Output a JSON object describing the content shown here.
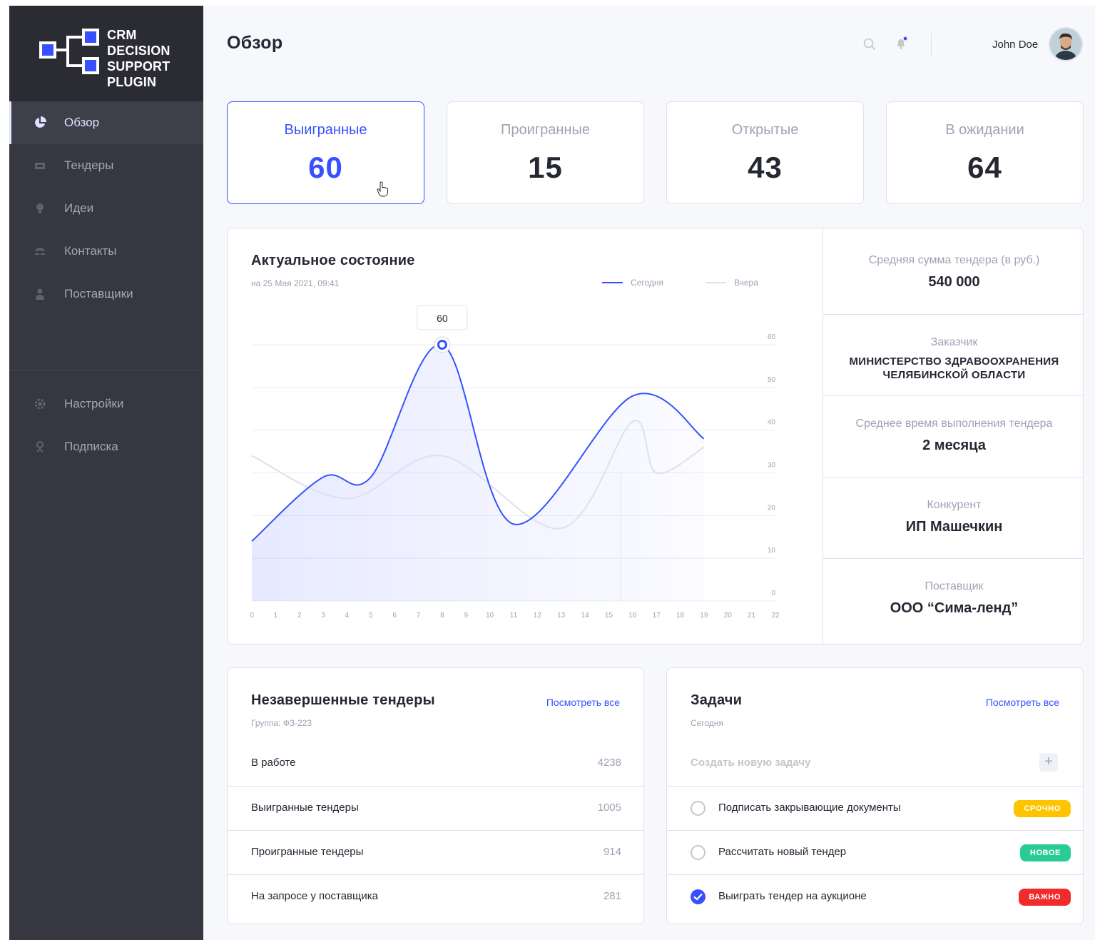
{
  "logo": {
    "lines": [
      "CRM",
      "DECISION",
      "SUPPORT",
      "PLUGIN"
    ]
  },
  "sidebar": {
    "items": [
      {
        "label": "Обзор",
        "icon": "pie-chart-icon"
      },
      {
        "label": "Тендеры",
        "icon": "ticket-icon"
      },
      {
        "label": "Идеи",
        "icon": "lightbulb-icon"
      },
      {
        "label": "Контакты",
        "icon": "people-icon"
      },
      {
        "label": "Поставщики",
        "icon": "person-icon"
      }
    ],
    "bottom_items": [
      {
        "label": "Настройки",
        "icon": "gear-icon"
      },
      {
        "label": "Подписка",
        "icon": "award-icon"
      }
    ]
  },
  "header": {
    "title": "Обзор",
    "user_name": "John Doe"
  },
  "stats": [
    {
      "label": "Выигранные",
      "value": "60"
    },
    {
      "label": "Проигранные",
      "value": "15"
    },
    {
      "label": "Открытые",
      "value": "43"
    },
    {
      "label": "В ожидании",
      "value": "64"
    }
  ],
  "chart": {
    "title": "Актуальное состояние",
    "subtitle": "на 25 Мая 2021, 09:41",
    "tooltip": "60"
  },
  "chart_data": {
    "type": "line",
    "x": [
      0,
      1,
      2,
      3,
      4,
      5,
      6,
      7,
      8,
      9,
      10,
      11,
      12,
      13,
      14,
      15,
      16,
      17,
      18,
      19,
      20,
      21,
      22
    ],
    "x_ticks": [
      "0",
      "1",
      "2",
      "3",
      "4",
      "5",
      "6",
      "7",
      "8",
      "9",
      "10",
      "11",
      "12",
      "13",
      "14",
      "15",
      "16",
      "17",
      "18",
      "19",
      "20",
      "21",
      "22"
    ],
    "y_ticks": [
      "60",
      "50",
      "40",
      "30",
      "20",
      "10",
      "0"
    ],
    "ylim": [
      0,
      60
    ],
    "series": [
      {
        "name": "Сегодня",
        "color": "#3751ff",
        "x": [
          0,
          3,
          5,
          8,
          11,
          16,
          19
        ],
        "values": [
          14,
          29,
          29,
          60,
          18,
          48,
          38
        ]
      },
      {
        "name": "Вчера",
        "color": "#dfe0eb",
        "x": [
          0,
          4,
          8,
          13,
          16,
          17,
          19
        ],
        "values": [
          34,
          24,
          34,
          17,
          42,
          30,
          36
        ]
      }
    ],
    "highlight": {
      "x": 8,
      "value": 60
    },
    "legend_position": "top-right"
  },
  "side_stats": [
    {
      "label": "Средняя сумма тендера (в руб.)",
      "value": "540 000"
    },
    {
      "label": "Заказчик",
      "value": "МИНИСТЕРСТВО ЗДРАВООХРАНЕНИЯ ЧЕЛЯБИНСКОЙ ОБЛАСТИ"
    },
    {
      "label": "Среднее время выполнения тендера",
      "value": "2 месяца"
    },
    {
      "label": "Конкурент",
      "value": "ИП Машечкин"
    },
    {
      "label": "Поставщик",
      "value": "ООО “Сима-ленд”"
    }
  ],
  "tenders": {
    "title": "Незавершенные тендеры",
    "subtitle": "Группа: ФЗ-223",
    "link": "Посмотреть все",
    "rows": [
      {
        "label": "В работе",
        "value": "4238"
      },
      {
        "label": "Выигранные тендеры",
        "value": "1005"
      },
      {
        "label": "Проигранные тендеры",
        "value": "914"
      },
      {
        "label": "На запросе у поставщика",
        "value": "281"
      }
    ]
  },
  "tasks": {
    "title": "Задачи",
    "subtitle": "Сегодня",
    "link": "Посмотреть все",
    "new_task_placeholder": "Создать новую задачу",
    "add_label": "+",
    "items": [
      {
        "label": "Подписать закрывающие документы",
        "badge": "СРОЧНО",
        "badge_color": "#fec400",
        "done": false
      },
      {
        "label": "Рассчитать новый тендер",
        "badge": "НОВОЕ",
        "badge_color": "#29cc97",
        "done": false
      },
      {
        "label": "Выиграть тендер на аукционе",
        "badge": "ВАЖНО",
        "badge_color": "#f12b2c",
        "done": true
      }
    ]
  }
}
